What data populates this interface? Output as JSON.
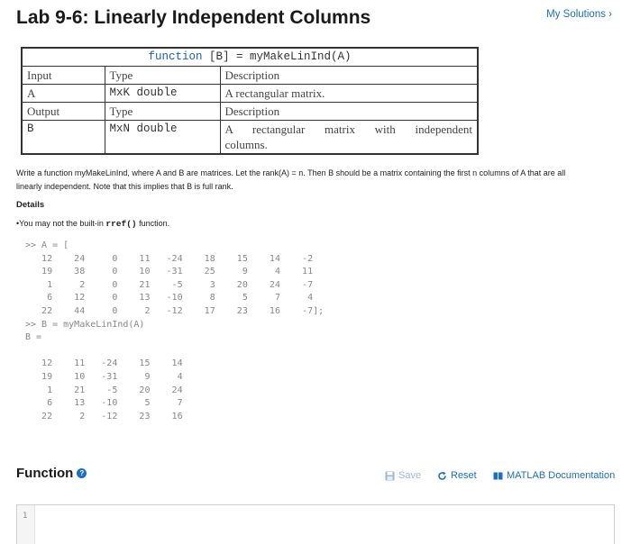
{
  "header": {
    "title": "Lab 9-6: Linearly Independent Columns",
    "my_solutions": "My Solutions ›"
  },
  "signature": {
    "keyword": "function",
    "rest": " [B] = myMakeLinInd(A)",
    "rows": [
      {
        "c1": "Input",
        "c2": "Type",
        "c3": "Description",
        "s1": "serif",
        "s2": "serif",
        "s3": "serif"
      },
      {
        "c1": "A",
        "c2": "MxK double",
        "c3": "A rectangular matrix.",
        "s1": "serif",
        "s2": "mono",
        "s3": "serif"
      },
      {
        "c1": "Output",
        "c2": "Type",
        "c3": "Description",
        "s1": "serif",
        "s2": "serif",
        "s3": "serif"
      },
      {
        "c1": "B",
        "c2": "MxN double",
        "c3_line1": "A rectangular matrix with independent",
        "c3_line2": "columns.",
        "s1": "serif",
        "s2": "mono",
        "s3": "serif"
      }
    ]
  },
  "description": "Write a function myMakeLinInd, where A and B are matrices. Let the rank(A) = n. Then B should be a matrix containing the first n columns of A that are all linearly independent. Note that this implies that B is full rank.",
  "details_label": "Details",
  "bullet": {
    "prefix": "•You may not the built-in ",
    "code": "rref()",
    "suffix": " function."
  },
  "code_example": ">> A = [\n   12    24     0    11   -24    18    15    14    -2\n   19    38     0    10   -31    25     9     4    11\n    1     2     0    21    -5     3    20    24    -7\n    6    12     0    13   -10     8     5     7     4\n   22    44     0     2   -12    17    23    16    -7];\n>> B = myMakeLinInd(A)\nB =\n\n   12    11   -24    15    14\n   19    10   -31     9     4\n    1    21    -5    20    24\n    6    13   -10     5     7\n   22     2   -12    23    16",
  "function_section": {
    "title": "Function",
    "help_icon": "help-icon",
    "save_label": "Save",
    "reset_label": "Reset",
    "doc_label": "MATLAB Documentation"
  },
  "editor": {
    "line_number": "1"
  },
  "colors": {
    "link": "#1a6fc4",
    "disabled": "#9bb8d8"
  }
}
